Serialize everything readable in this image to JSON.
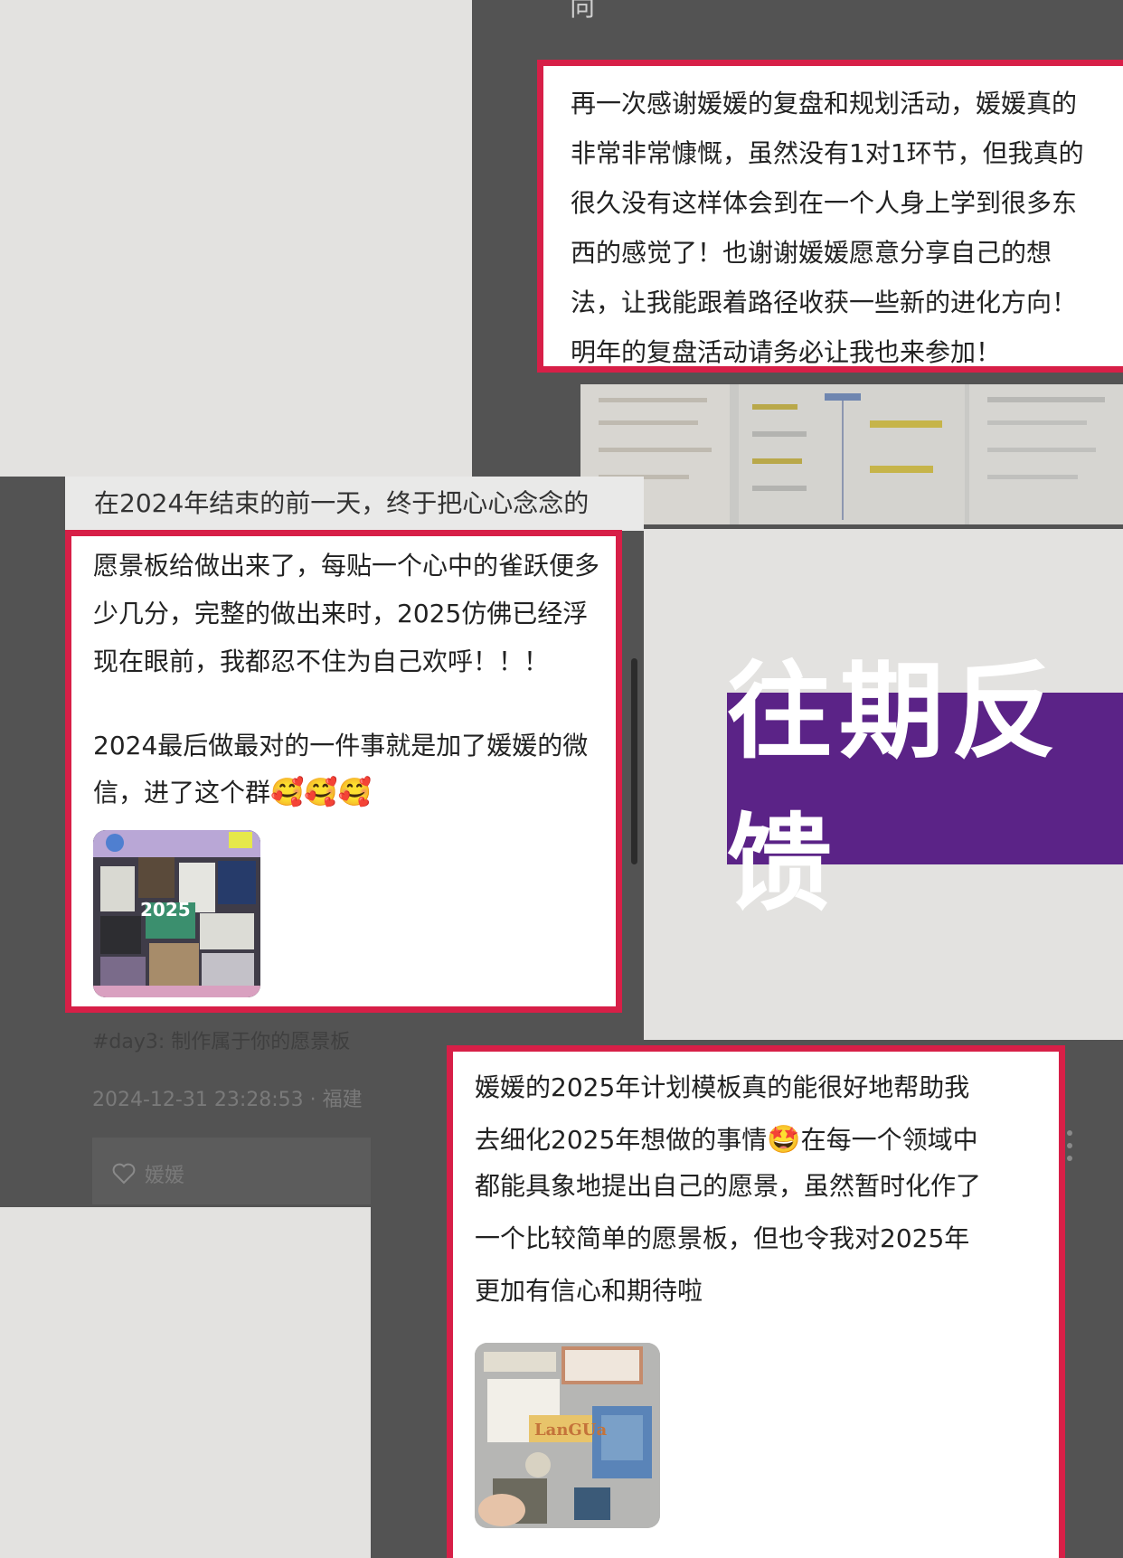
{
  "top_fragment": "向",
  "testimonial_1": {
    "text": "再一次感谢媛媛的复盘和规划活动，媛媛真的\n非常非常慷慨，虽然没有1对1环节，但我真的\n很久没有这样体会到在一个人身上学到很多东\n西的感觉了！也谢谢媛媛愿意分享自己的想\n法，让我能跟着路径收获一些新的进化方向！\n明年的复盘活动请务必让我也来参加！"
  },
  "post_2": {
    "line_1": "在2024年结束的前一天，终于把心心念念的",
    "body": "愿景板给做出来了，每贴一个心中的雀跃便多\n少几分，完整的做出来时，2025仿佛已经浮\n现在眼前，我都忍不住为自己欢呼！！！",
    "line_4_prefix": "2024最后做最对的一件事就是加了媛媛的微",
    "line_5_prefix": "信，进了这个群",
    "emojis": "🥰🥰🥰",
    "hashtag": "#day3: 制作属于你的愿景板",
    "timestamp": "2024-12-31 23:28:53 · 福建",
    "like_name": "媛媛",
    "board_year": "2025"
  },
  "banner": {
    "title": "往期反馈"
  },
  "testimonial_3": {
    "line_1": "媛媛的2025年计划模板真的能很好地帮助我",
    "line_2_prefix": "去细化2025年想做的事情",
    "line_2_emoji": "🤩",
    "line_2_suffix": "在每一个领域中",
    "rest": "都能具象地提出自己的愿景，虽然暂时化作了\n一个比较简单的愿景板，但也令我对2025年\n更加有信心和期待啦",
    "board_word": "LanGUa"
  },
  "colors": {
    "highlight": "#d71f47",
    "banner_bg": "#5b2387",
    "dark_panel": "#535353"
  }
}
